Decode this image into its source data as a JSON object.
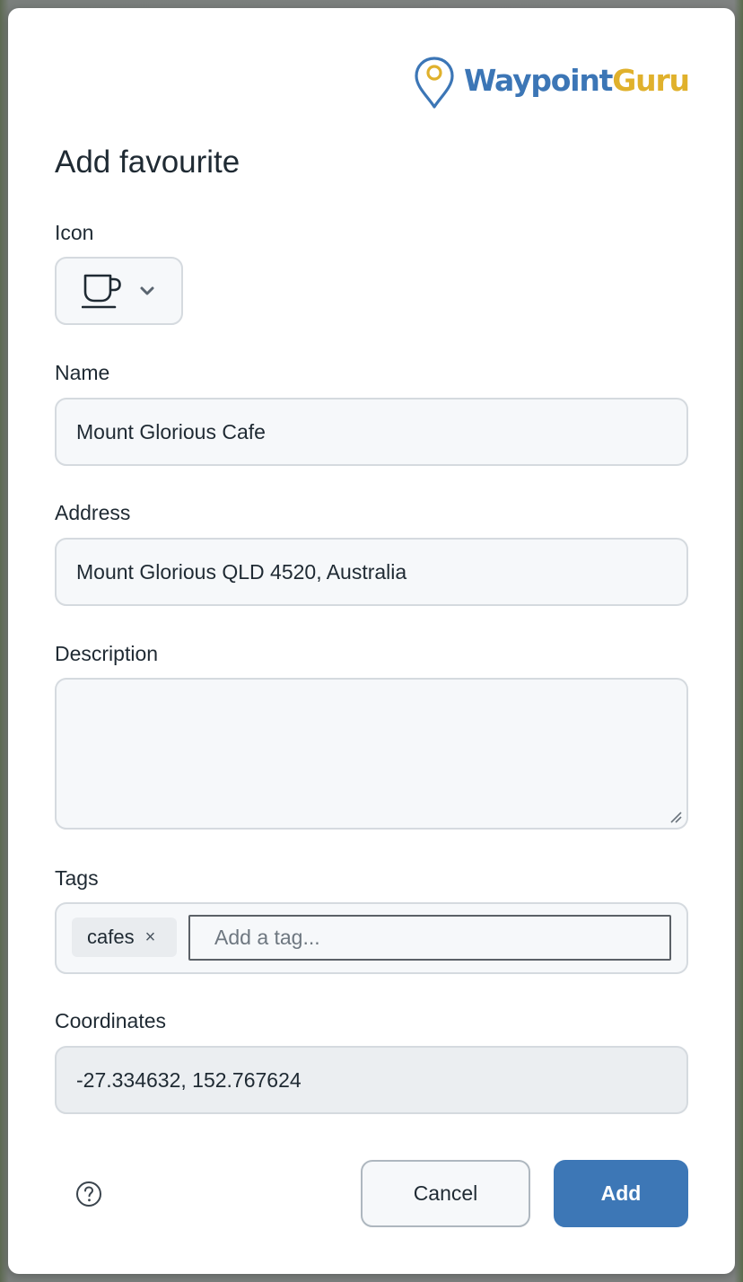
{
  "brand": {
    "name_part1": "Waypoint",
    "name_part2": "Guru",
    "color_primary": "#3c76b6",
    "color_accent": "#e0b12c"
  },
  "dialog": {
    "title": "Add favourite"
  },
  "icon_field": {
    "label": "Icon",
    "selected_icon": "coffee-cup-icon"
  },
  "name_field": {
    "label": "Name",
    "value": "Mount Glorious Cafe"
  },
  "address_field": {
    "label": "Address",
    "value": "Mount Glorious QLD 4520, Australia"
  },
  "description_field": {
    "label": "Description",
    "value": ""
  },
  "tags_field": {
    "label": "Tags",
    "tags": [
      {
        "label": "cafes",
        "remove_glyph": "×"
      }
    ],
    "placeholder": "Add a tag..."
  },
  "coordinates_field": {
    "label": "Coordinates",
    "value": "-27.334632, 152.767624"
  },
  "actions": {
    "help_icon": "help-circle-icon",
    "cancel_label": "Cancel",
    "add_label": "Add",
    "add_color": "#3d77b6"
  }
}
